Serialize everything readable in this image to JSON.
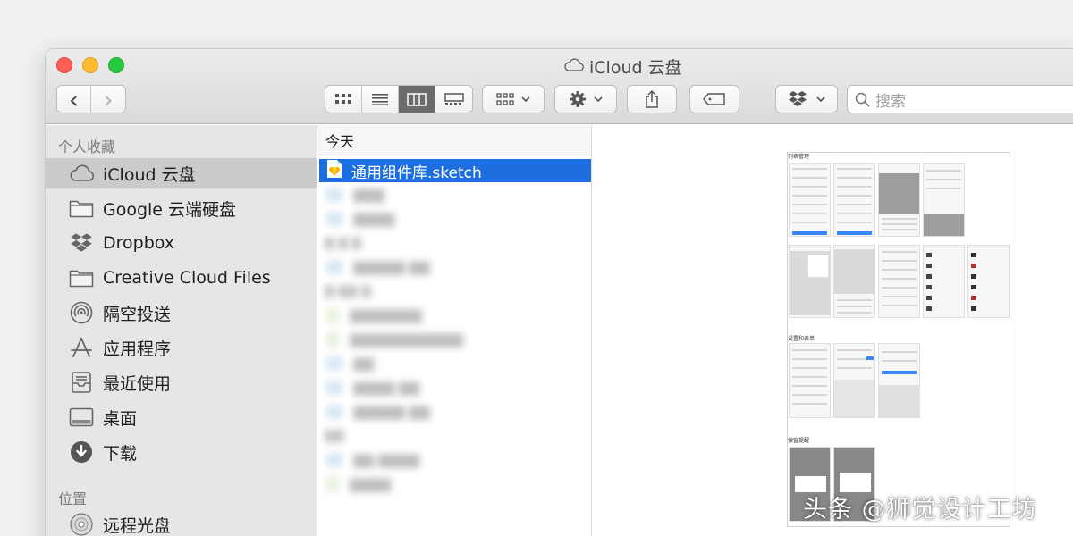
{
  "window": {
    "title": "iCloud 云盘"
  },
  "toolbar": {
    "back_label": "‹",
    "forward_label": "›",
    "search_placeholder": "搜索"
  },
  "sidebar": {
    "favorites_heading": "个人收藏",
    "favorites": [
      {
        "label": "iCloud 云盘",
        "icon": "cloud-icon",
        "selected": true
      },
      {
        "label": "Google 云端硬盘",
        "icon": "folder-icon"
      },
      {
        "label": "Dropbox",
        "icon": "dropbox-icon"
      },
      {
        "label": "Creative Cloud Files",
        "icon": "folder-icon"
      },
      {
        "label": "隔空投送",
        "icon": "airdrop-icon"
      },
      {
        "label": "应用程序",
        "icon": "applications-icon"
      },
      {
        "label": "最近使用",
        "icon": "recents-icon"
      },
      {
        "label": "桌面",
        "icon": "desktop-icon"
      },
      {
        "label": "下载",
        "icon": "downloads-icon"
      }
    ],
    "locations_heading": "位置",
    "locations": [
      {
        "label": "远程光盘",
        "icon": "disc-icon"
      }
    ]
  },
  "column": {
    "header": "今天",
    "selected_file": "通用组件库.sketch"
  },
  "preview": {
    "section_1": "列表管理",
    "section_2": "设置和表单",
    "section_3": "弹窗提醒"
  },
  "watermark": "头条 @狮觉设计工坊",
  "colors": {
    "selection": "#1d6fe0",
    "red": "#fd5d57",
    "yellow": "#fdbc2f",
    "green": "#28c840"
  }
}
